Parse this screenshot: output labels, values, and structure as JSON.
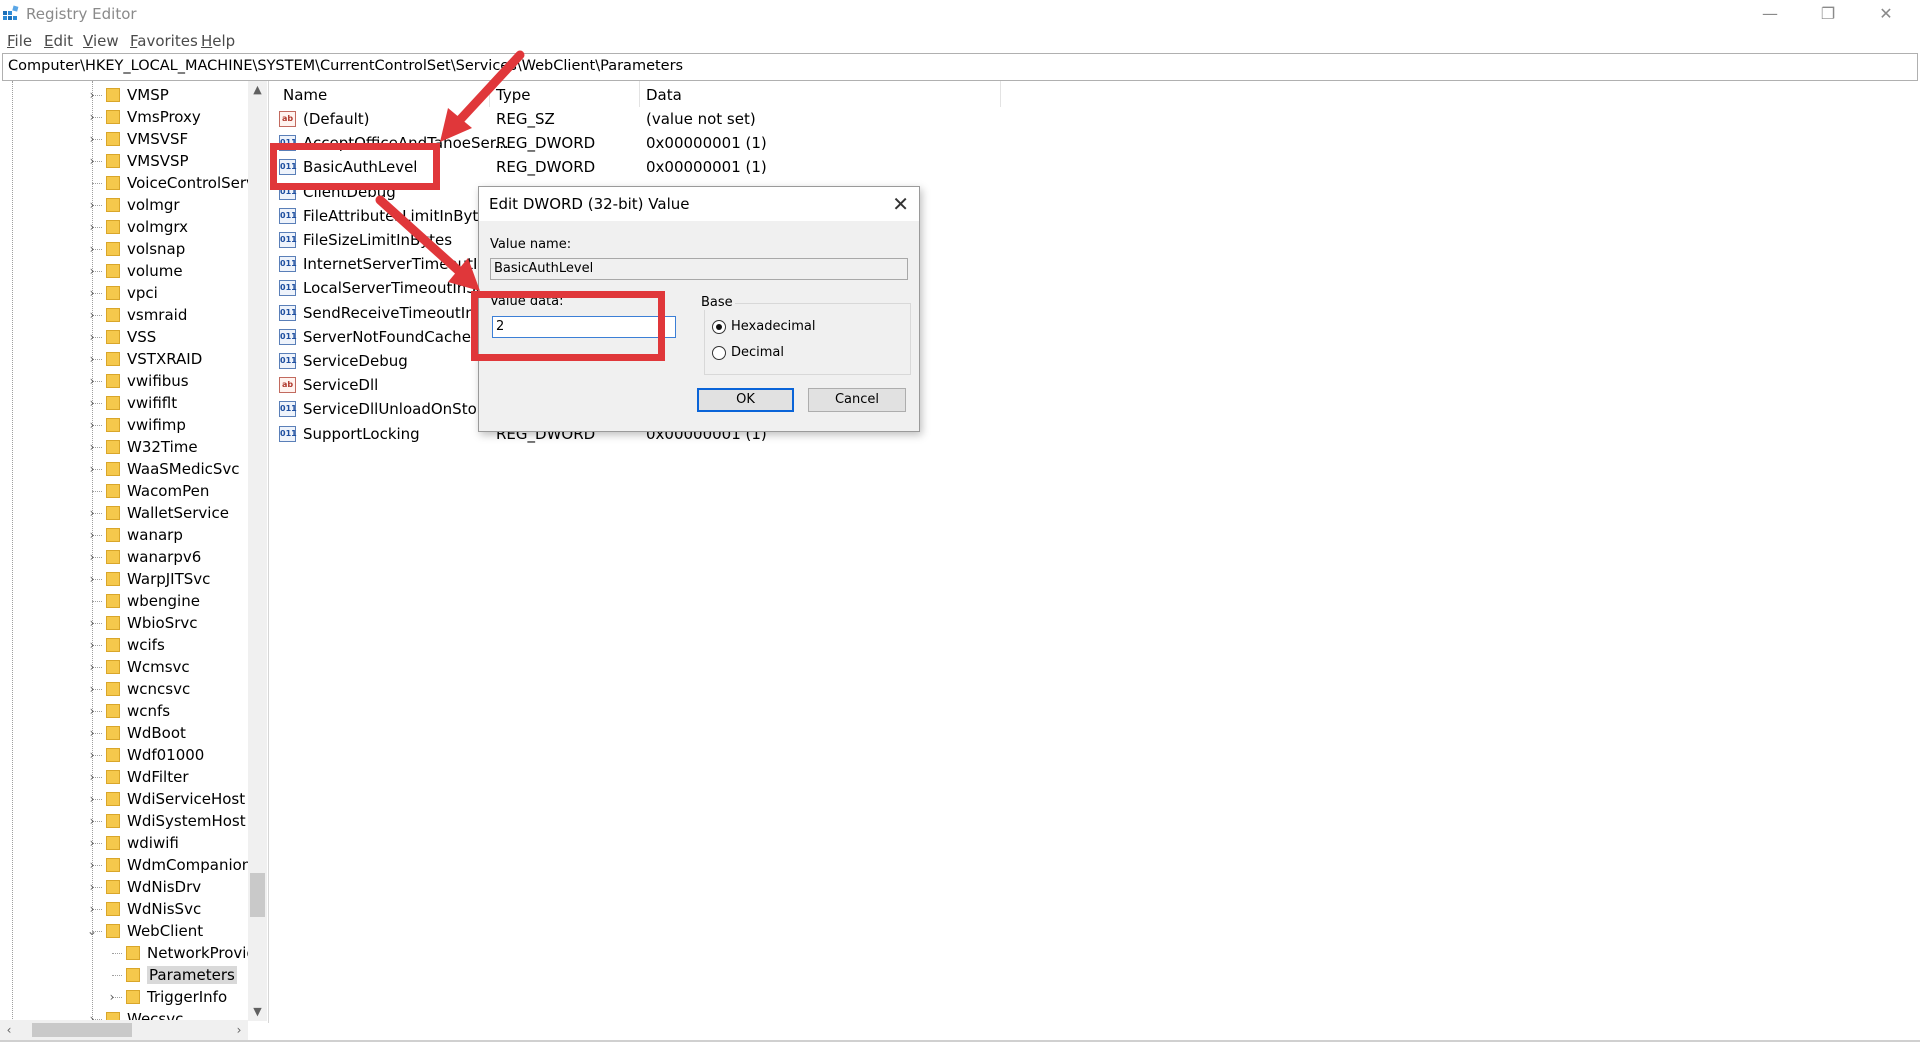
{
  "window": {
    "title": "Registry Editor",
    "minimize": "—",
    "maximize": "❐",
    "close": "✕"
  },
  "menu": [
    {
      "label": "File",
      "key": "F",
      "rest": "ile"
    },
    {
      "label": "Edit",
      "key": "E",
      "rest": "dit"
    },
    {
      "label": "View",
      "key": "V",
      "rest": "iew"
    },
    {
      "label": "Favorites",
      "key": "F",
      "rest": "avorites"
    },
    {
      "label": "Help",
      "key": "H",
      "rest": "elp"
    }
  ],
  "address": "Computer\\HKEY_LOCAL_MACHINE\\SYSTEM\\CurrentControlSet\\Services\\WebClient\\Parameters",
  "tree": {
    "items": [
      {
        "label": "VMSP",
        "expandable": true,
        "depth": 0
      },
      {
        "label": "VmsProxy",
        "expandable": true,
        "depth": 0
      },
      {
        "label": "VMSVSF",
        "expandable": true,
        "depth": 0
      },
      {
        "label": "VMSVSP",
        "expandable": true,
        "depth": 0
      },
      {
        "label": "VoiceControlServi",
        "expandable": false,
        "depth": 0
      },
      {
        "label": "volmgr",
        "expandable": true,
        "depth": 0
      },
      {
        "label": "volmgrx",
        "expandable": true,
        "depth": 0
      },
      {
        "label": "volsnap",
        "expandable": true,
        "depth": 0
      },
      {
        "label": "volume",
        "expandable": true,
        "depth": 0
      },
      {
        "label": "vpci",
        "expandable": true,
        "depth": 0
      },
      {
        "label": "vsmraid",
        "expandable": true,
        "depth": 0
      },
      {
        "label": "VSS",
        "expandable": true,
        "depth": 0
      },
      {
        "label": "VSTXRAID",
        "expandable": true,
        "depth": 0
      },
      {
        "label": "vwifibus",
        "expandable": true,
        "depth": 0
      },
      {
        "label": "vwififlt",
        "expandable": true,
        "depth": 0
      },
      {
        "label": "vwifimp",
        "expandable": true,
        "depth": 0
      },
      {
        "label": "W32Time",
        "expandable": true,
        "depth": 0
      },
      {
        "label": "WaaSMedicSvc",
        "expandable": true,
        "depth": 0
      },
      {
        "label": "WacomPen",
        "expandable": false,
        "depth": 0
      },
      {
        "label": "WalletService",
        "expandable": true,
        "depth": 0
      },
      {
        "label": "wanarp",
        "expandable": true,
        "depth": 0
      },
      {
        "label": "wanarpv6",
        "expandable": true,
        "depth": 0
      },
      {
        "label": "WarpJITSvc",
        "expandable": true,
        "depth": 0
      },
      {
        "label": "wbengine",
        "expandable": false,
        "depth": 0
      },
      {
        "label": "WbioSrvc",
        "expandable": true,
        "depth": 0
      },
      {
        "label": "wcifs",
        "expandable": true,
        "depth": 0
      },
      {
        "label": "Wcmsvc",
        "expandable": true,
        "depth": 0
      },
      {
        "label": "wcncsvc",
        "expandable": true,
        "depth": 0
      },
      {
        "label": "wcnfs",
        "expandable": true,
        "depth": 0
      },
      {
        "label": "WdBoot",
        "expandable": true,
        "depth": 0
      },
      {
        "label": "Wdf01000",
        "expandable": true,
        "depth": 0
      },
      {
        "label": "WdFilter",
        "expandable": true,
        "depth": 0
      },
      {
        "label": "WdiServiceHost",
        "expandable": true,
        "depth": 0
      },
      {
        "label": "WdiSystemHost",
        "expandable": true,
        "depth": 0
      },
      {
        "label": "wdiwifi",
        "expandable": true,
        "depth": 0
      },
      {
        "label": "WdmCompanionF",
        "expandable": true,
        "depth": 0
      },
      {
        "label": "WdNisDrv",
        "expandable": true,
        "depth": 0
      },
      {
        "label": "WdNisSvc",
        "expandable": true,
        "depth": 0
      },
      {
        "label": "WebClient",
        "expandable": true,
        "expanded": true,
        "depth": 0
      },
      {
        "label": "NetworkProvid",
        "expandable": false,
        "depth": 1
      },
      {
        "label": "Parameters",
        "expandable": false,
        "depth": 1,
        "selected": true
      },
      {
        "label": "TriggerInfo",
        "expandable": true,
        "depth": 1
      },
      {
        "label": "Wecsvc",
        "expandable": true,
        "depth": 0
      }
    ]
  },
  "list": {
    "columns": [
      "Name",
      "Type",
      "Data"
    ],
    "rows": [
      {
        "icon": "string-value-icon",
        "name": "(Default)",
        "type": "REG_SZ",
        "data": "(value not set)"
      },
      {
        "icon": "dword-value-icon",
        "name": "AcceptOfficeAndTahoeSer...",
        "type": "REG_DWORD",
        "data": "0x00000001 (1)"
      },
      {
        "icon": "dword-value-icon",
        "name": "BasicAuthLevel",
        "type": "REG_DWORD",
        "data": "0x00000001 (1)"
      },
      {
        "icon": "dword-value-icon",
        "name": "ClientDebug",
        "type": "",
        "data": ""
      },
      {
        "icon": "dword-value-icon",
        "name": "FileAttributesLimitInBytes",
        "type": "",
        "data": ""
      },
      {
        "icon": "dword-value-icon",
        "name": "FileSizeLimitInBytes",
        "type": "",
        "data": ""
      },
      {
        "icon": "dword-value-icon",
        "name": "InternetServerTimeoutInSec",
        "type": "",
        "data": ""
      },
      {
        "icon": "dword-value-icon",
        "name": "LocalServerTimeoutInSec",
        "type": "",
        "data": ""
      },
      {
        "icon": "dword-value-icon",
        "name": "SendReceiveTimeoutInSec",
        "type": "",
        "data": ""
      },
      {
        "icon": "dword-value-icon",
        "name": "ServerNotFoundCacheLifeTimeInSec",
        "type": "",
        "data": ""
      },
      {
        "icon": "dword-value-icon",
        "name": "ServiceDebug",
        "type": "",
        "data": ""
      },
      {
        "icon": "string-value-icon",
        "name": "ServiceDll",
        "type": "",
        "data": ""
      },
      {
        "icon": "dword-value-icon",
        "name": "ServiceDllUnloadOnStop",
        "type": "",
        "data": ""
      },
      {
        "icon": "dword-value-icon",
        "name": "SupportLocking",
        "type": "REG_DWORD",
        "data": "0x00000001 (1)"
      }
    ]
  },
  "dialog": {
    "title": "Edit DWORD (32-bit) Value",
    "close": "✕",
    "value_name_label": "Value name:",
    "value_name": "BasicAuthLevel",
    "value_data_label": "Value data:",
    "value_data": "2",
    "base_label": "Base",
    "radio_hex": "Hexadecimal",
    "radio_dec": "Decimal",
    "selected_base": "Hexadecimal",
    "ok": "OK",
    "cancel": "Cancel"
  },
  "colors": {
    "highlight": "#e0373a",
    "folder": "#f5c84c",
    "accent": "#0a64d8"
  },
  "icons": {
    "app": "registry-editor-icon",
    "dword": "dword-value-icon",
    "string": "string-value-icon",
    "folder": "folder-icon"
  }
}
